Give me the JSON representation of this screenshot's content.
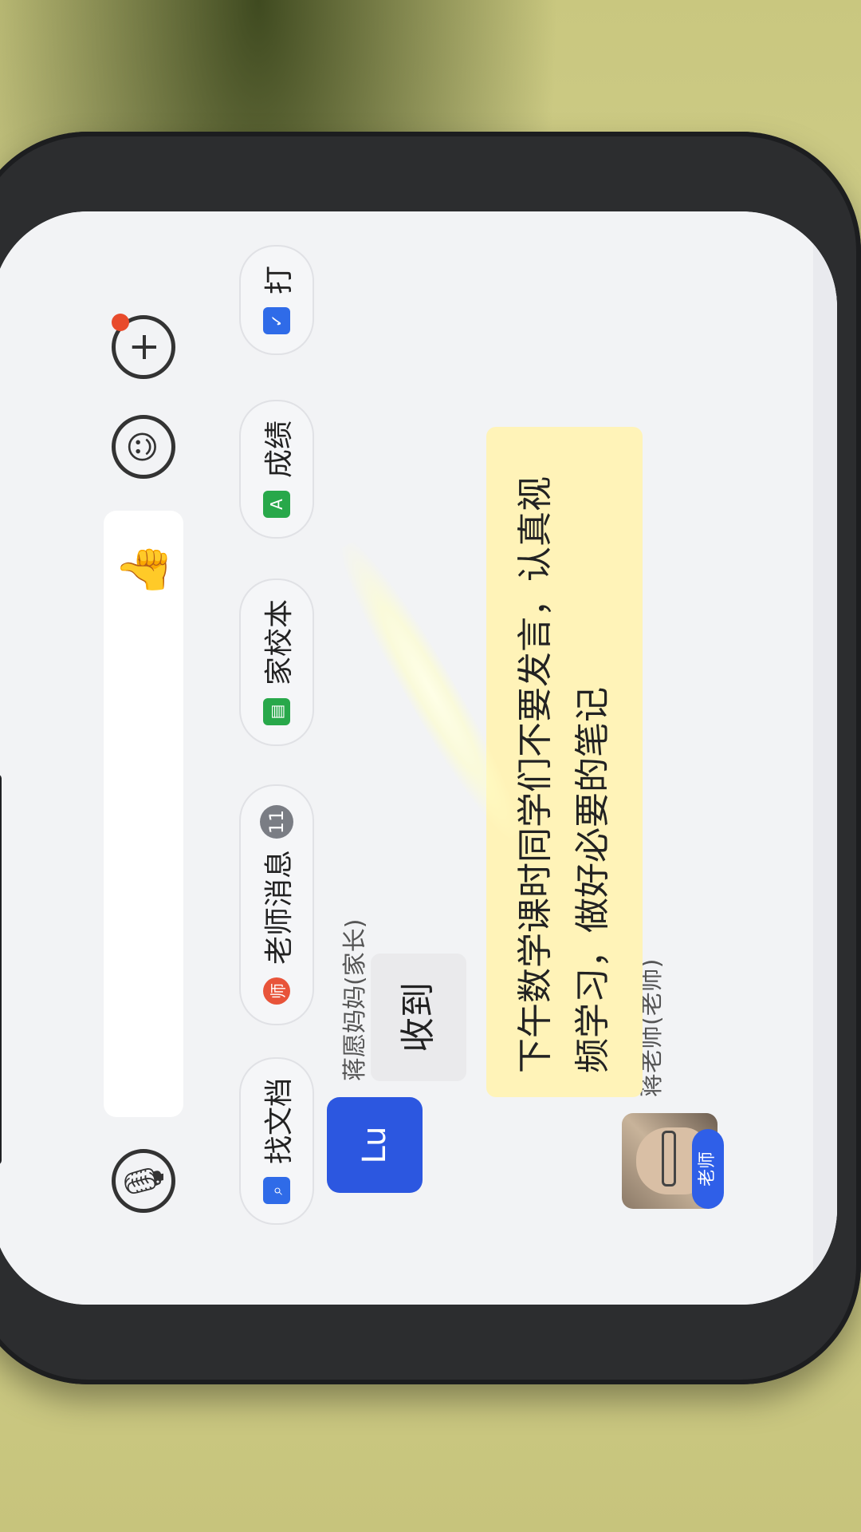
{
  "chat": {
    "teacher": {
      "name": "蒋老师(老师)",
      "badge": "老师",
      "message": "下午数学课时同学们不要发言，认真视频学习，做好必要的笔记"
    },
    "parent": {
      "avatar_text": "Lu",
      "name": "蒋愿妈妈(家长)",
      "message": "收到"
    }
  },
  "quickbar": {
    "items": [
      {
        "label": "找文档",
        "icon": "document-search-icon",
        "color": "#2f6be8"
      },
      {
        "label": "老师消息",
        "icon": "teacher-icon",
        "color": "#e8543a",
        "badge": "11"
      },
      {
        "label": "家校本",
        "icon": "notebook-icon",
        "color": "#28a84a"
      },
      {
        "label": "成绩",
        "icon": "grade-icon",
        "color": "#28a84a"
      },
      {
        "label": "打",
        "icon": "checkin-icon",
        "color": "#2f6be8"
      }
    ]
  },
  "inputbar": {
    "voice_icon": "voice-icon",
    "like_icon": "thumbs-up-icon",
    "emoji_icon": "emoji-icon",
    "plus_icon": "plus-icon"
  }
}
